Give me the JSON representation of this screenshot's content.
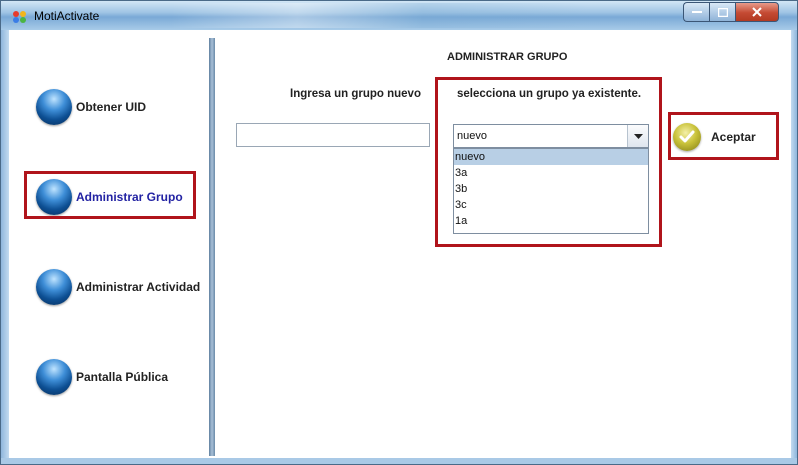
{
  "window": {
    "title": "MotiActivate"
  },
  "sidebar": {
    "items": [
      {
        "label": "Obtener UID"
      },
      {
        "label": "Administrar Grupo"
      },
      {
        "label": "Administrar Actividad"
      },
      {
        "label": "Pantalla Pública"
      }
    ],
    "active_index": 1
  },
  "main": {
    "title": "ADMINISTRAR GRUPO",
    "new_group_label": "Ingresa un grupo nuevo",
    "new_group_value": "",
    "existing_group_label": "selecciona un grupo ya existente.",
    "combo_selected": "nuevo",
    "combo_options": [
      "nuevo",
      "3a",
      "3b",
      "3c",
      "1a"
    ],
    "accept_label": "Aceptar"
  },
  "colors": {
    "highlight": "#b0141b",
    "active_nav_text": "#2323a3",
    "selected_option_bg": "#b8cfe5"
  },
  "icons": {
    "nav": "blue-orb-icon",
    "accept": "checkmark-icon",
    "app": "app-logo-icon"
  }
}
